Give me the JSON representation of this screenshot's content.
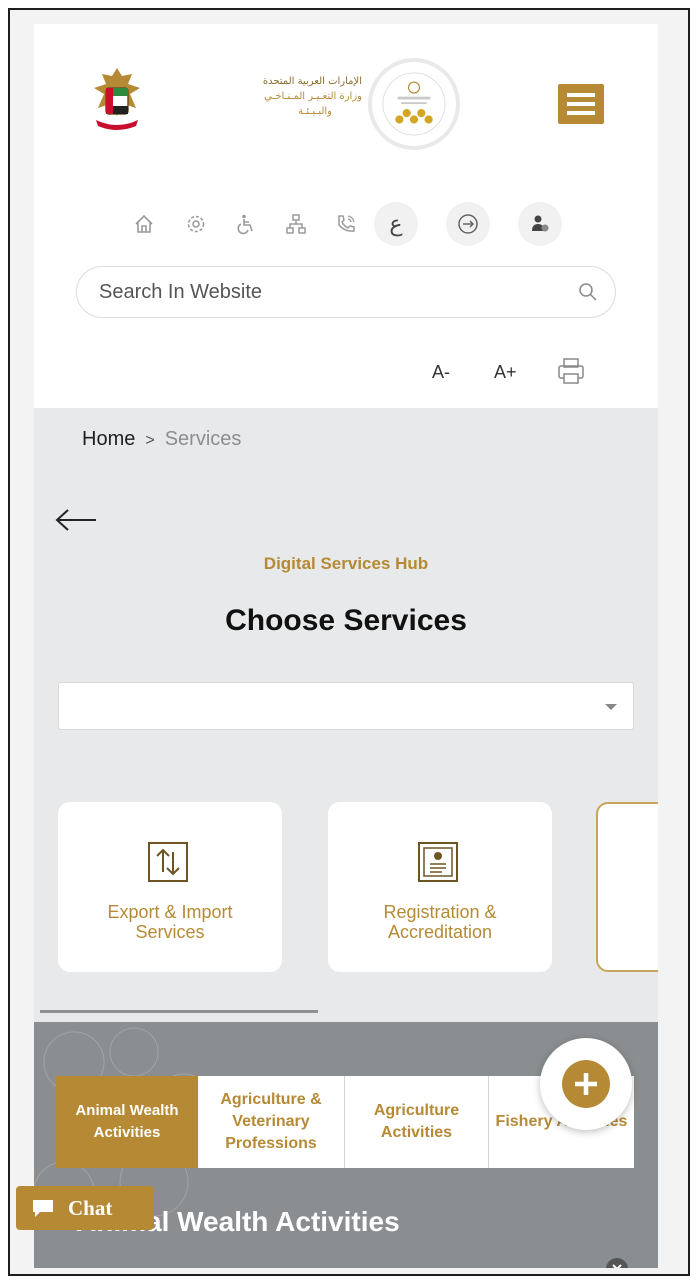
{
  "header": {
    "logo_lines": [
      "الإمارات العربية المتحدة",
      "وزارة التغـيـر المـنـاخـي",
      "والبـيـئـة"
    ]
  },
  "utility_icons": [
    "home-icon",
    "settings-icon",
    "accessibility-icon",
    "sitemap-icon",
    "phone-icon",
    "arabic-language-icon",
    "login-icon",
    "user-profile-icon"
  ],
  "language_toggle": "ع",
  "search": {
    "placeholder": "Search In Website"
  },
  "font_tools": {
    "decrease": "A-",
    "increase": "A+"
  },
  "breadcrumb": {
    "home": "Home",
    "separator": ">",
    "current": "Services"
  },
  "hub": {
    "subtitle": "Digital Services Hub",
    "title": "Choose Services"
  },
  "service_cards": [
    {
      "icon": "export-import-icon",
      "label_line1": "Export & Import",
      "label_line2": "Services"
    },
    {
      "icon": "certificate-icon",
      "label_line1": "Registration &",
      "label_line2": "Accreditation"
    }
  ],
  "tabs": [
    {
      "line1": "Animal Wealth",
      "line2": "Activities",
      "line3": "",
      "active": true
    },
    {
      "line1": "Agriculture &",
      "line2": "Veterinary",
      "line3": "Professions",
      "active": false
    },
    {
      "line1": "Agriculture",
      "line2": "Activities",
      "line3": "",
      "active": false
    },
    {
      "line1": "Fishery Activities",
      "line2": "",
      "line3": "",
      "active": false
    }
  ],
  "section_title": "Animal Wealth Activities",
  "chat": {
    "label": "Chat"
  },
  "colors": {
    "accent": "#b68a35",
    "band": "#e8e9ea",
    "dark_band": "#8b8e90"
  }
}
